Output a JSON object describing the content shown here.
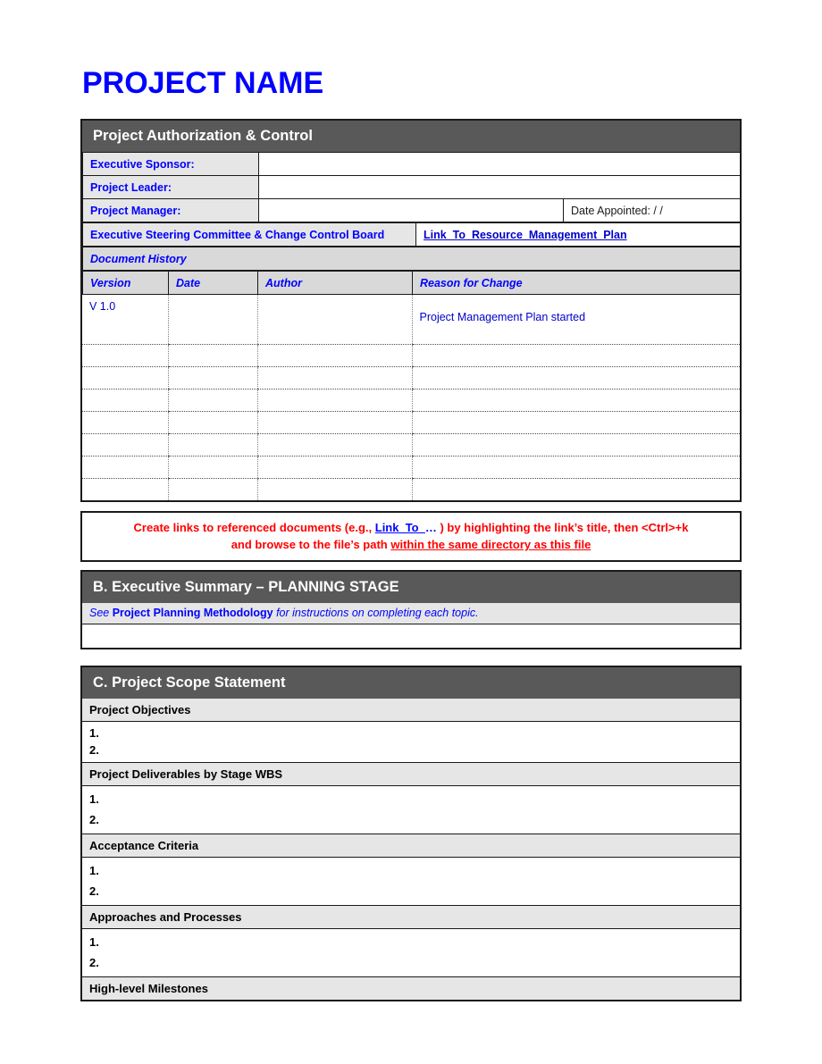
{
  "document": {
    "title": "PROJECT NAME"
  },
  "section_a": {
    "header": "Project Authorization  & Control",
    "rows": [
      {
        "label": "Executive Sponsor:",
        "value": ""
      },
      {
        "label": "Project Leader:",
        "value": ""
      },
      {
        "label": "Project Manager:",
        "value": "",
        "extra_label": "Date Appointed:   /  /"
      }
    ],
    "esc_row": {
      "label": "Executive Steering Committee & Change Control Board",
      "link": "Link_To_Resource_Management_Plan"
    },
    "document_history": {
      "title": "Document History",
      "columns": [
        "Version",
        "Date",
        "Author",
        "Reason for Change"
      ],
      "rows": [
        {
          "version": "V 1.0",
          "date": "",
          "author": "",
          "reason": "Project Management Plan started"
        },
        {
          "version": "",
          "date": "",
          "author": "",
          "reason": ""
        },
        {
          "version": "",
          "date": "",
          "author": "",
          "reason": ""
        },
        {
          "version": "",
          "date": "",
          "author": "",
          "reason": ""
        },
        {
          "version": "",
          "date": "",
          "author": "",
          "reason": ""
        },
        {
          "version": "",
          "date": "",
          "author": "",
          "reason": ""
        },
        {
          "version": "",
          "date": "",
          "author": "",
          "reason": ""
        },
        {
          "version": "",
          "date": "",
          "author": "",
          "reason": ""
        }
      ]
    }
  },
  "notice": {
    "line1_pre": "Create links to referenced documents (e.g., ",
    "line1_link": "Link_To_",
    "line1_link_tail": "…",
    "line1_post": " ) by highlighting the link’s title, then <Ctrl>+k",
    "line2_pre": "and browse to the file’s path ",
    "line2_underline": "within the same directory as this file"
  },
  "section_b": {
    "header": "B.  Executive Summary – PLANNING STAGE",
    "note_pre": "See ",
    "note_bold": "Project Planning Methodology",
    "note_post": " for instructions on completing each topic.",
    "body": ""
  },
  "section_c": {
    "header": "C.  Project Scope Statement",
    "groups": [
      {
        "title": "Project Objectives",
        "items": [
          "1.",
          "2."
        ]
      },
      {
        "title": "Project Deliverables by Stage WBS",
        "items": [
          "1.",
          "2."
        ]
      },
      {
        "title": "Acceptance Criteria",
        "items": [
          "1.",
          "2."
        ]
      },
      {
        "title": "Approaches and Processes",
        "items": [
          "1.",
          "2."
        ]
      },
      {
        "title": "High-level Milestones",
        "items": []
      }
    ]
  },
  "colors": {
    "bar_gray": "#595959",
    "label_gray": "#E6E6E6",
    "header_gray": "#D9D9D9",
    "blue": "#0000FF",
    "link_blue": "#0000CC",
    "red": "#FF0000"
  }
}
